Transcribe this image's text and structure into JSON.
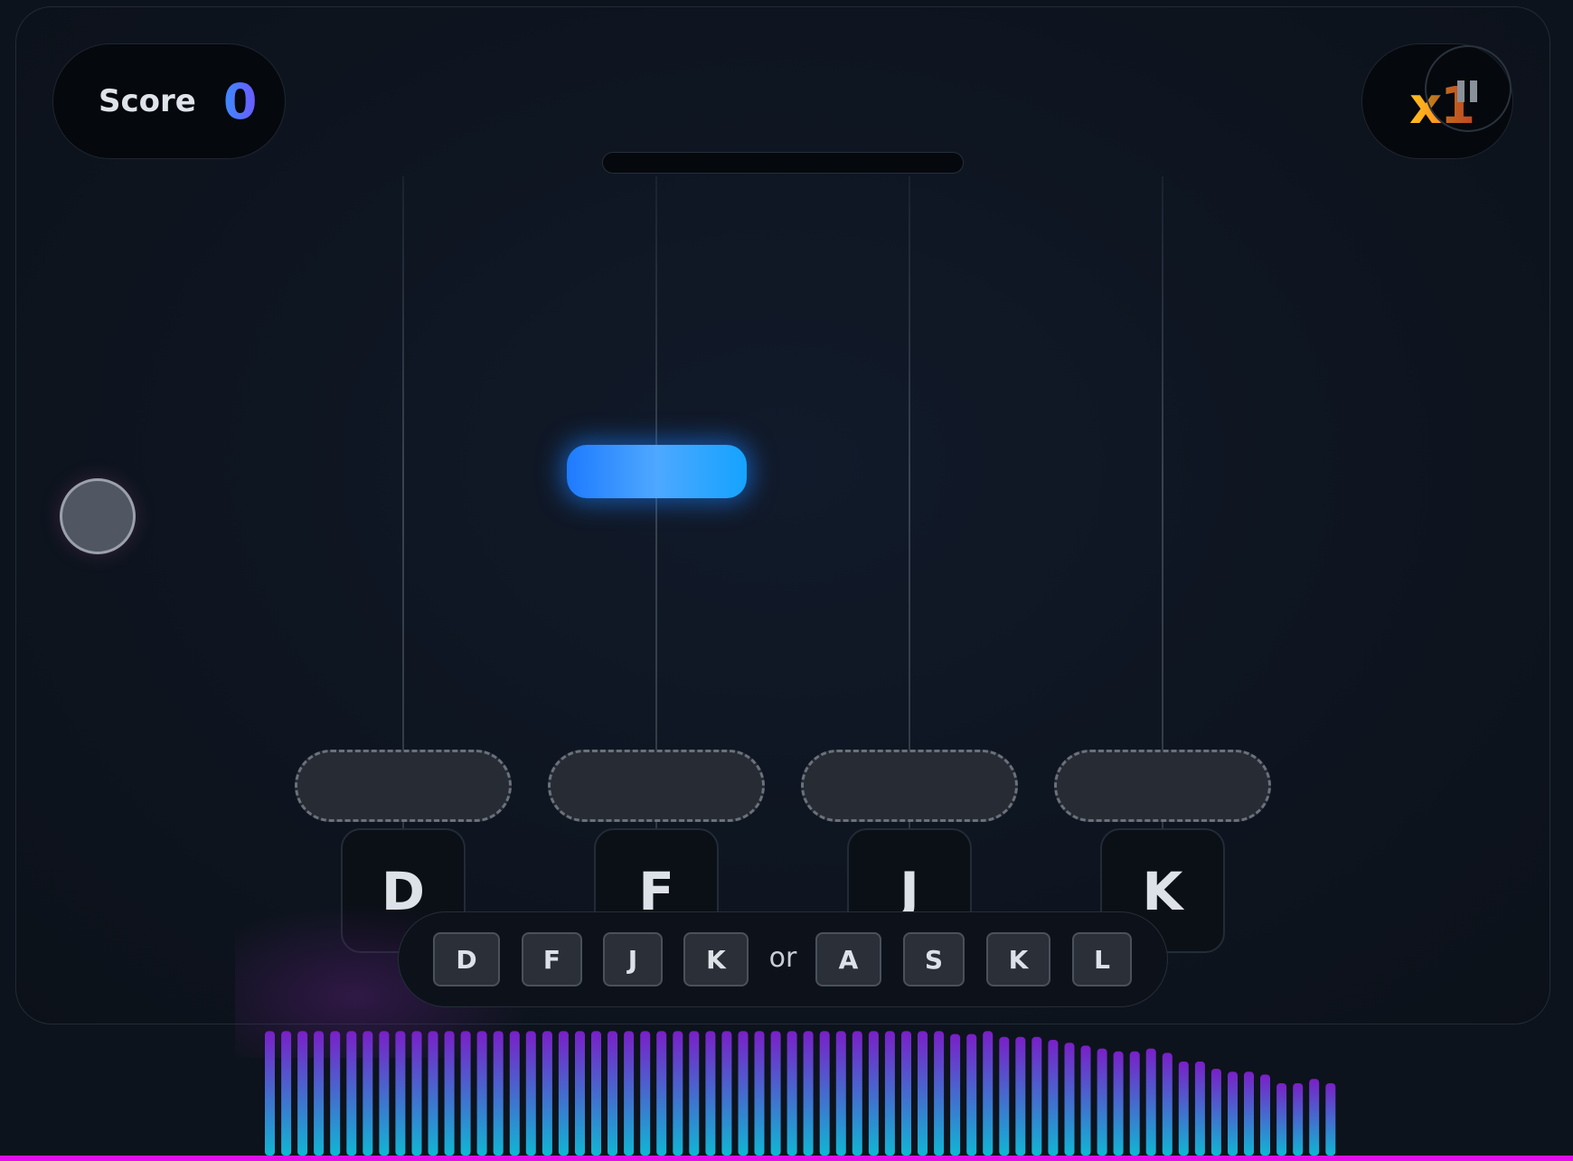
{
  "hud": {
    "score_label": "Score",
    "score_value": "0",
    "multiplier": "x1"
  },
  "lanes": [
    {
      "key": "D"
    },
    {
      "key": "F"
    },
    {
      "key": "J"
    },
    {
      "key": "K"
    }
  ],
  "controls_hint": {
    "primary_keys": [
      "D",
      "F",
      "J",
      "K"
    ],
    "separator": "or",
    "alternate_keys": [
      "A",
      "S",
      "K",
      "L"
    ]
  },
  "visualizer": {
    "bar_levels": [
      0.86,
      0.86,
      0.86,
      0.86,
      0.86,
      0.86,
      0.86,
      0.86,
      0.86,
      0.86,
      0.86,
      0.86,
      0.86,
      0.86,
      0.86,
      0.86,
      0.86,
      0.86,
      0.86,
      0.86,
      0.86,
      0.86,
      0.86,
      0.86,
      0.86,
      0.86,
      0.86,
      0.86,
      0.86,
      0.86,
      0.86,
      0.86,
      0.86,
      0.86,
      0.86,
      0.86,
      0.86,
      0.86,
      0.86,
      0.86,
      0.86,
      0.86,
      0.84,
      0.84,
      0.86,
      0.82,
      0.82,
      0.82,
      0.8,
      0.78,
      0.76,
      0.74,
      0.72,
      0.72,
      0.74,
      0.71,
      0.65,
      0.65,
      0.6,
      0.58,
      0.58,
      0.56,
      0.5,
      0.5,
      0.53,
      0.5
    ],
    "color_top": "#7a1fc8",
    "color_bottom": "#10b6d4"
  },
  "colors": {
    "note": "#2f8dff",
    "accent_bottom_line": "#e010e8"
  }
}
